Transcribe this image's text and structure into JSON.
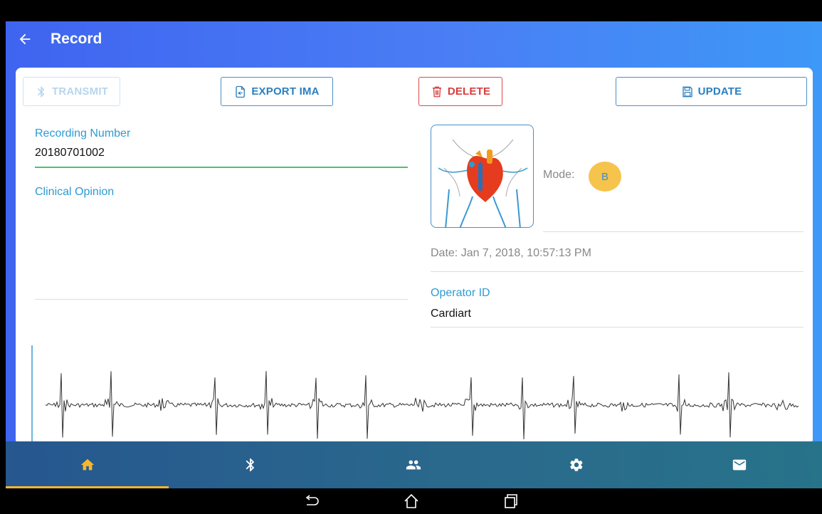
{
  "app_bar": {
    "title": "Record"
  },
  "toolbar": {
    "transmit_label": "TRANSMIT",
    "export_label": "EXPORT IMA",
    "delete_label": "DELETE",
    "update_label": "UPDATE"
  },
  "form": {
    "recording_number_label": "Recording Number",
    "recording_number_value": "20180701002",
    "clinical_opinion_label": "Clinical Opinion",
    "clinical_opinion_value": "",
    "mode_label": "Mode:",
    "mode_value": "B",
    "date_text": "Date: Jan 7, 2018, 10:57:13 PM",
    "operator_label": "Operator ID",
    "operator_value": "Cardiart"
  },
  "bottom_nav": {
    "items": [
      {
        "icon": "home-icon",
        "active": true
      },
      {
        "icon": "bluetooth-icon",
        "active": false
      },
      {
        "icon": "people-icon",
        "active": false
      },
      {
        "icon": "gear-icon",
        "active": false
      },
      {
        "icon": "mail-icon",
        "active": false
      }
    ],
    "active_color": "#f5b731",
    "icon_color": "#ffffff"
  },
  "colors": {
    "accent": "#2d9bd3",
    "delete": "#d83c3c",
    "mode_badge": "#f6c34c",
    "focus_line": "#4cc36a"
  }
}
